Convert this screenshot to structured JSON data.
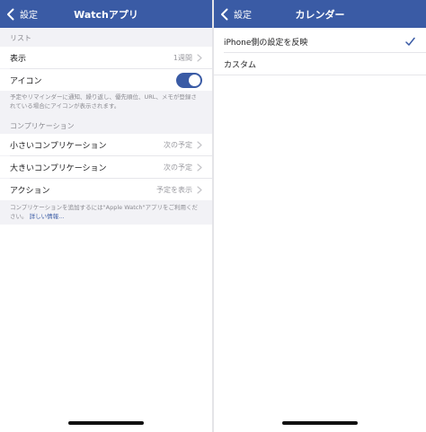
{
  "left_screen": {
    "nav": {
      "back_label": "設定",
      "title": "Watchアプリ"
    },
    "section_list_header": "リスト",
    "row_display": {
      "label": "表示",
      "value": "1週間"
    },
    "row_icon": {
      "label": "アイコン",
      "toggle_on": true
    },
    "icon_footer": "予定やリマインダーに通知、繰り返し、優先順位、URL、メモが登録されている場合にアイコンが表示されます。",
    "section_complication_header": "コンプリケーション",
    "row_small": {
      "label": "小さいコンプリケーション",
      "value": "次の予定"
    },
    "row_large": {
      "label": "大きいコンプリケーション",
      "value": "次の予定"
    },
    "row_action": {
      "label": "アクション",
      "value": "予定を表示"
    },
    "complication_footer_text": "コンプリケーションを追加するには\"Apple Watch\"アプリをご利用ください。",
    "complication_footer_link": "詳しい情報..."
  },
  "right_screen": {
    "nav": {
      "back_label": "設定",
      "title": "カレンダー"
    },
    "row_reflect": {
      "label": "iPhone側の設定を反映",
      "checked": true
    },
    "row_custom": {
      "label": "カスタム"
    }
  },
  "colors": {
    "nav_bar": "#3a5ba5",
    "accent": "#3a5ba5",
    "grouped_background": "#f2f2f6"
  }
}
